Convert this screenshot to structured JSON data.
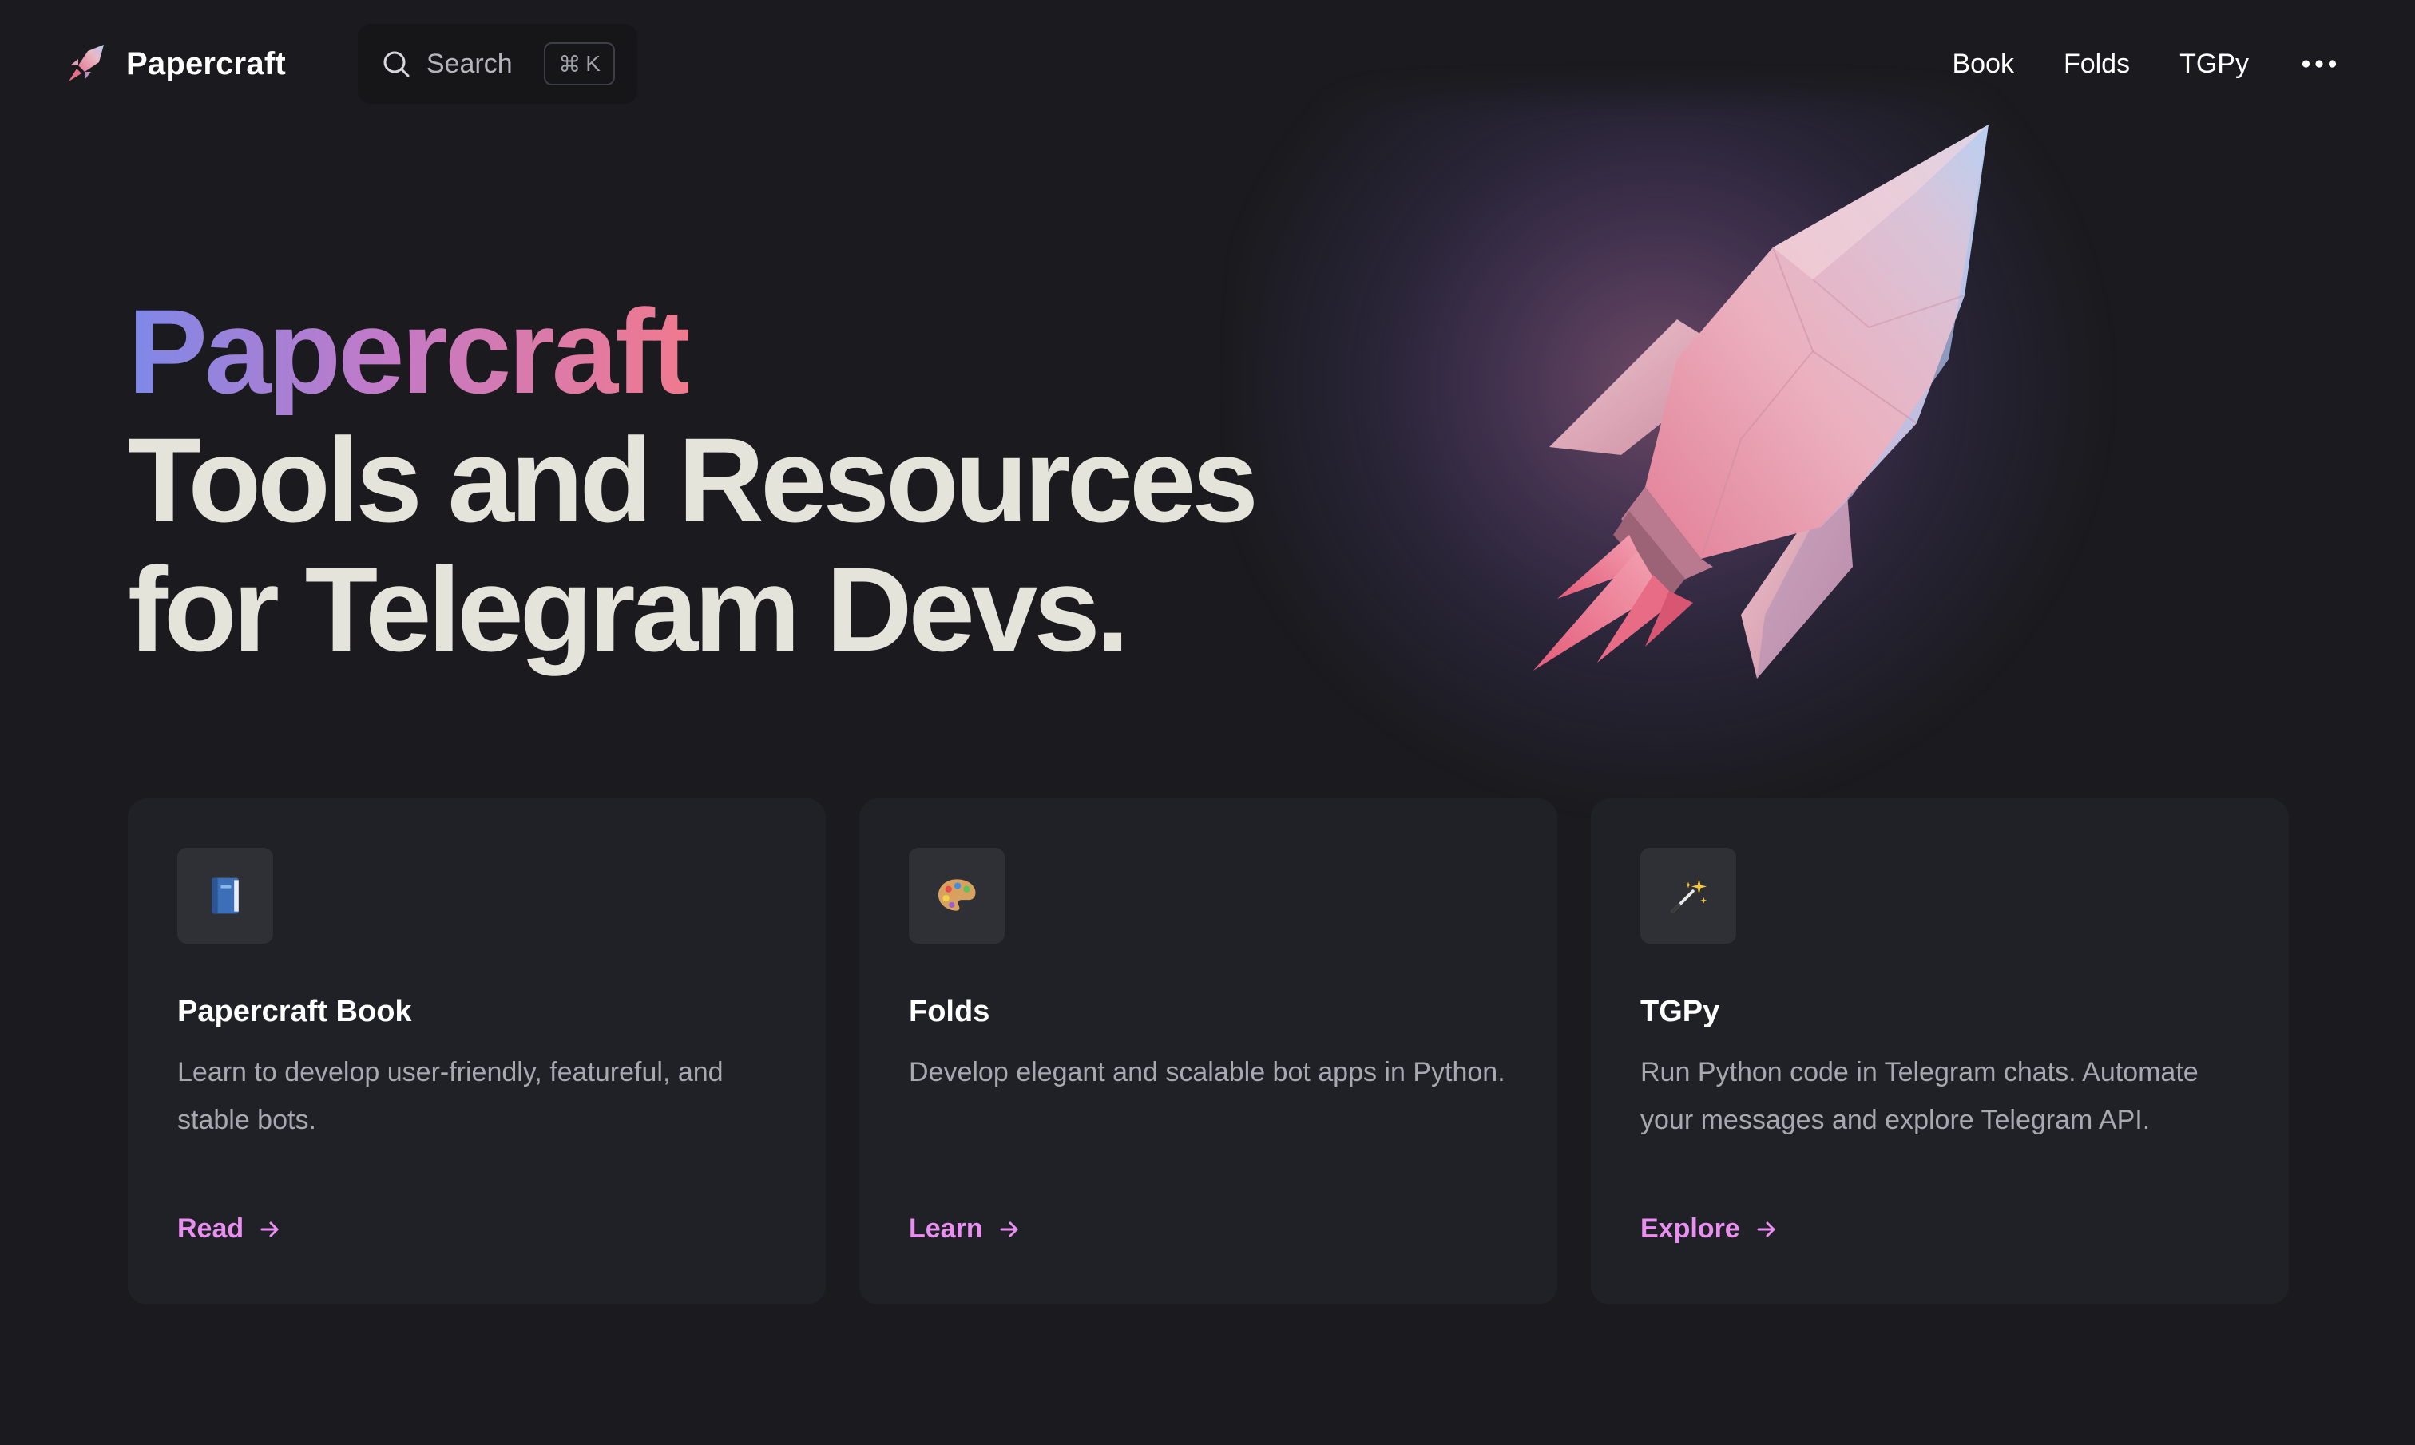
{
  "header": {
    "brand_name": "Papercraft",
    "search": {
      "label": "Search",
      "shortcut_symbol": "⌘",
      "shortcut_key": "K"
    },
    "nav": [
      {
        "label": "Book"
      },
      {
        "label": "Folds"
      },
      {
        "label": "TGPy"
      }
    ],
    "more_icon": "ellipsis-icon"
  },
  "hero": {
    "title": "Papercraft",
    "tagline_line1": "Tools and Resources",
    "tagline_line2": "for Telegram Devs.",
    "image_icon": "rocket-icon"
  },
  "cards": [
    {
      "icon": "blue-book-icon",
      "title": "Papercraft Book",
      "description": "Learn to develop user-friendly, featureful, and stable bots.",
      "link": "Read"
    },
    {
      "icon": "artist-palette-icon",
      "title": "Folds",
      "description": "Develop elegant and scalable bot apps in Python.",
      "link": "Learn"
    },
    {
      "icon": "magic-wand-icon",
      "title": "TGPy",
      "description": "Run Python code in Telegram chats. Automate your messages and explore Telegram API.",
      "link": "Explore"
    }
  ],
  "colors": {
    "background": "#1b1b1f",
    "card_background": "#202127",
    "link_accent": "#e98ff0",
    "title_gradient": [
      "#7e88e8",
      "#c27ac8",
      "#f07a8e"
    ]
  }
}
